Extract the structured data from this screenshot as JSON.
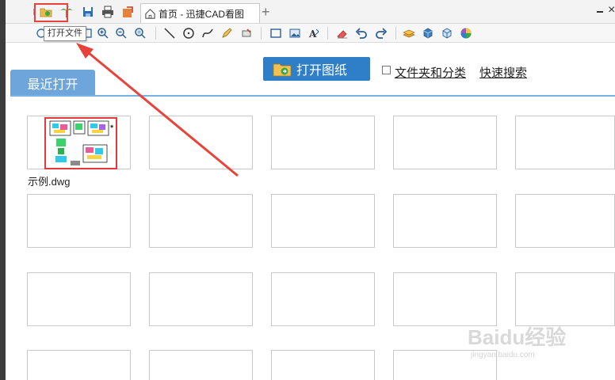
{
  "titlebar": {
    "home_tab_label": "首页 - 迅捷CAD看图",
    "add_tab_label": "+",
    "close_label": "×"
  },
  "toolbar": {
    "tooltip": "打开文件"
  },
  "main": {
    "open_button_label": "打开图纸",
    "folder_category_label": "文件夹和分类",
    "quick_search_label": "快速搜索",
    "recent_tab_label": "最近打开",
    "recent_files": [
      {
        "name": "示例.dwg"
      }
    ]
  },
  "watermark": {
    "main": "Baidu经验",
    "sub": "jingyan.baidu.com"
  },
  "colors": {
    "accent": "#2e7fc8",
    "recent_tab": "#6ea6dc",
    "highlight": "#e8433a"
  }
}
